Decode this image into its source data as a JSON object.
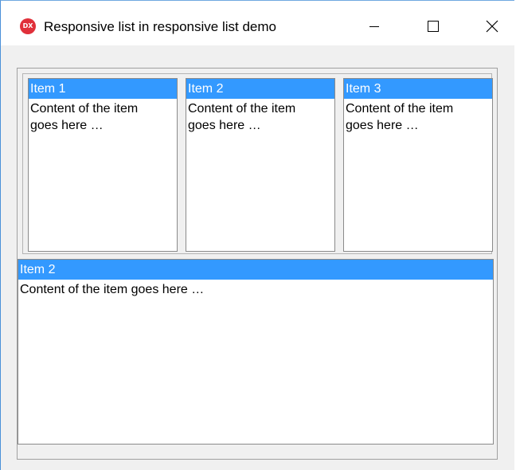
{
  "window": {
    "title": "Responsive list in responsive list demo",
    "icon": "app-dx-icon",
    "icon_text": "DX",
    "controls": [
      "minimize-icon",
      "maximize-icon",
      "close-icon"
    ]
  },
  "list": {
    "items": [
      {
        "header": "Item 1",
        "content": "Content of the item goes here …"
      },
      {
        "header": "Item 2",
        "content": "Content of the item goes here …"
      },
      {
        "header": "Item 3",
        "content": "Content of the item goes here …"
      }
    ]
  },
  "detail": {
    "header": "Item 2",
    "content": "Content of the item goes here …"
  },
  "colors": {
    "selection": "#3399ff",
    "app_icon": "#e0303a"
  }
}
